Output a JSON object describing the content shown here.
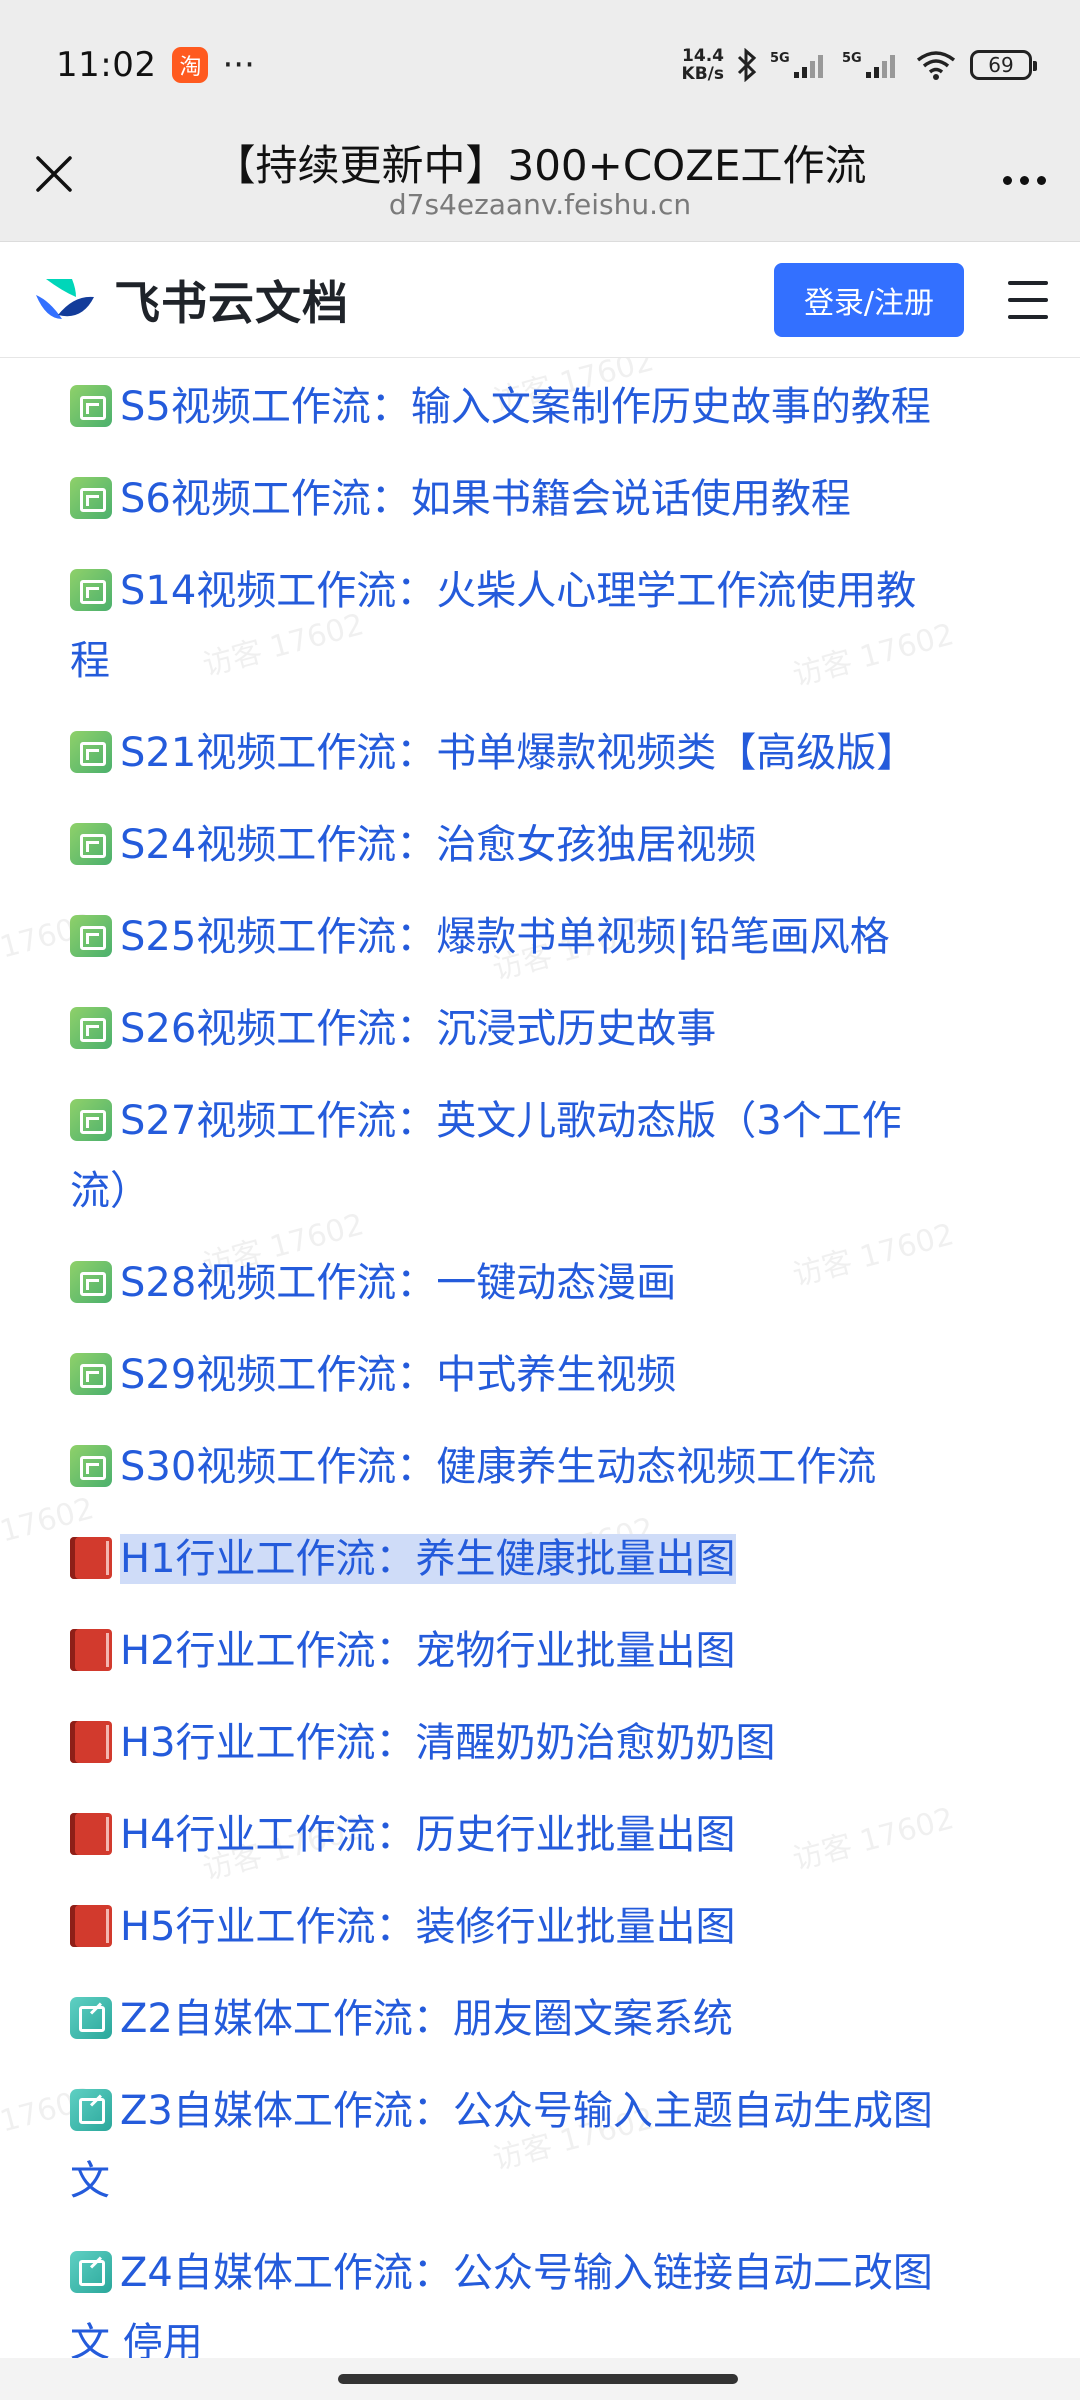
{
  "status_bar": {
    "time": "11:02",
    "app_badge": "淘",
    "more": "···",
    "speed_top": "14.4",
    "speed_bottom": "KB/s",
    "net1": "5G",
    "net2": "5G",
    "battery": "69"
  },
  "title_bar": {
    "title": "【持续更新中】300+COZE工作流",
    "subtitle": "d7s4ezaanv.feishu.cn"
  },
  "header": {
    "logo_text": "飞书云文档",
    "login_label": "登录/注册"
  },
  "watermark_text": "访客 17602",
  "items": [
    {
      "icon": "video-icon",
      "line1": "S5视频工作流：输入文案制作历史故事的教程"
    },
    {
      "icon": "video-icon",
      "line1": "S6视频工作流：如果书籍会说话使用教程"
    },
    {
      "icon": "video-icon",
      "line1": "S14视频工作流：火柴人心理学工作流使用教",
      "line2": "程"
    },
    {
      "icon": "video-icon",
      "line1": "S21视频工作流：书单爆款视频类【高级版】"
    },
    {
      "icon": "video-icon",
      "line1": "S24视频工作流：治愈女孩独居视频"
    },
    {
      "icon": "video-icon",
      "line1": "S25视频工作流：爆款书单视频|铅笔画风格"
    },
    {
      "icon": "video-icon",
      "line1": "S26视频工作流：沉浸式历史故事"
    },
    {
      "icon": "video-icon",
      "line1": "S27视频工作流：英文儿歌动态版（3个工作",
      "line2": "流）"
    },
    {
      "icon": "video-icon",
      "line1": "S28视频工作流：一键动态漫画"
    },
    {
      "icon": "video-icon",
      "line1": "S29视频工作流：中式养生视频"
    },
    {
      "icon": "video-icon",
      "line1": "S30视频工作流：健康养生动态视频工作流"
    },
    {
      "icon": "book-icon",
      "line1": "H1行业工作流：养生健康批量出图"
    },
    {
      "icon": "book-icon",
      "line1": "H2行业工作流：宠物行业批量出图"
    },
    {
      "icon": "book-icon",
      "line1": "H3行业工作流：清醒奶奶治愈奶奶图"
    },
    {
      "icon": "book-icon",
      "line1": "H4行业工作流：历史行业批量出图"
    },
    {
      "icon": "book-icon",
      "line1": "H5行业工作流：装修行业批量出图"
    },
    {
      "icon": "note-icon",
      "line1": "Z2自媒体工作流：朋友圈文案系统"
    },
    {
      "icon": "note-icon",
      "line1": "Z3自媒体工作流：公众号输入主题自动生成图",
      "line2": "文"
    },
    {
      "icon": "note-icon",
      "line1": "Z4自媒体工作流：公众号输入链接自动二改图",
      "line2": "文 停用"
    }
  ]
}
